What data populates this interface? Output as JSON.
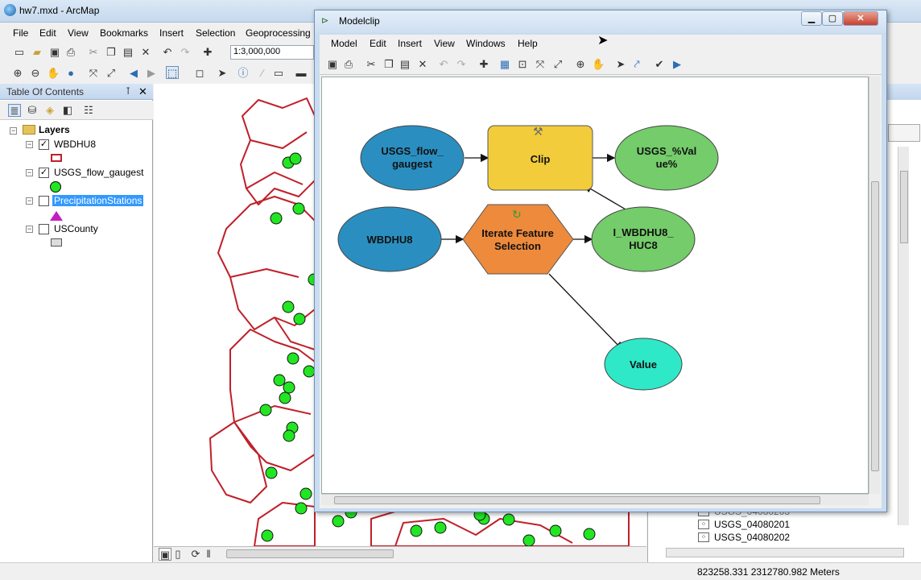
{
  "arcmap": {
    "title": "hw7.mxd - ArcMap",
    "menu": [
      "File",
      "Edit",
      "View",
      "Bookmarks",
      "Insert",
      "Selection",
      "Geoprocessing"
    ],
    "scale": "1:3,000,000"
  },
  "toc": {
    "title": "Table Of Contents",
    "group": "Layers",
    "layers": [
      {
        "name": "WBDHU8",
        "checked": true
      },
      {
        "name": "USGS_flow_gaugest",
        "checked": true
      },
      {
        "name": "PrecipitationStations",
        "checked": false,
        "selected": true
      },
      {
        "name": "USCounty",
        "checked": false
      }
    ]
  },
  "catalog": {
    "items": [
      "USGS_04080203",
      "USGS_04080201",
      "USGS_04080202"
    ]
  },
  "status": {
    "coords": "823258.331  2312780.982 Meters"
  },
  "model": {
    "title": "Modelclip",
    "menu": [
      "Model",
      "Edit",
      "Insert",
      "View",
      "Windows",
      "Help"
    ],
    "nodes": {
      "in1": [
        "USGS_flow_",
        "gaugest"
      ],
      "clip": "Clip",
      "out1": [
        "USGS_%Val",
        "ue%"
      ],
      "in2": "WBDHU8",
      "iterate": [
        "Iterate Feature",
        "Selection"
      ],
      "out2": [
        "I_WBDHU8_",
        "HUC8"
      ],
      "value": "Value"
    },
    "colors": {
      "input": "#2a8fc0",
      "tool": "#f2cc3a",
      "output": "#74cc6a",
      "iterator": "#ee8a3c",
      "value": "#2ee8c8"
    }
  }
}
